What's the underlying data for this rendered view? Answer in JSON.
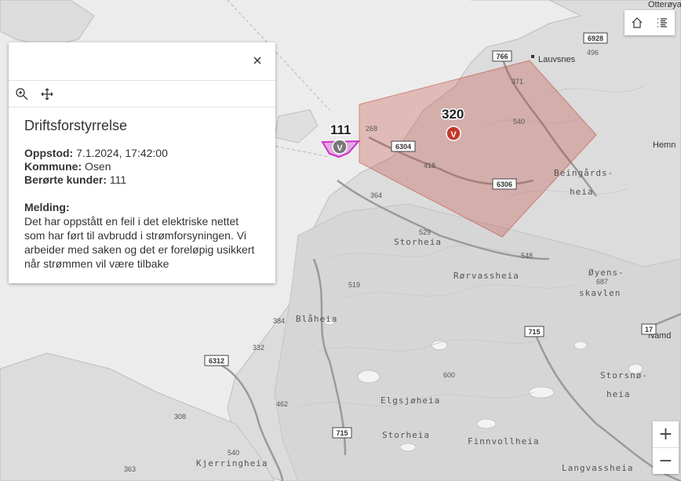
{
  "popup": {
    "title": "Driftsforstyrrelse",
    "fields": [
      {
        "label": "Oppstod:",
        "value": "7.1.2024, 17:42:00"
      },
      {
        "label": "Kommune:",
        "value": "Osen"
      },
      {
        "label": "Berørte kunder:",
        "value": "111"
      }
    ],
    "message_label": "Melding:",
    "message": "Det har oppstått en feil i det elektriske nettet som har ført til avbrudd i strømforsyningen. Vi arbeider med saken og det er foreløpig usikkert når strømmen vil være tilbake"
  },
  "outages": [
    {
      "count": "111",
      "color": "#cc33cc"
    },
    {
      "count": "320",
      "color": "#c0392b"
    }
  ],
  "places": {
    "ottervya": "Otterøya",
    "lauvsnes": "Lauvsnes",
    "hemne": "Hemn",
    "beingardsheia_1": "Beingårds-",
    "beingardsheia_2": "heia",
    "storheia_1": "Storheia",
    "rorvassheia": "Rørvassheia",
    "oyensskavlen_1": "Øyens-",
    "oyensskavlen_2": "skavlen",
    "blaheia": "Blåheia",
    "namd": "Namd",
    "storsnoheia_1": "Storsnø-",
    "storsnoheia_2": "heia",
    "elgsjoheia": "Elgsjøheia",
    "storheia_2": "Storheia",
    "finnvollheia": "Finnvollheia",
    "kjerringheia": "Kjerringheia",
    "langvassheia": "Langvassheia"
  },
  "roads": [
    "6928",
    "766",
    "6304",
    "6306",
    "715",
    "6312",
    "715",
    "17"
  ],
  "elevations": [
    "496",
    "371",
    "540",
    "268",
    "418",
    "364",
    "529",
    "548",
    "519",
    "687",
    "384",
    "332",
    "600",
    "462",
    "308",
    "540",
    "363"
  ],
  "widgets": {
    "zoom_in": "+",
    "zoom_out": "−"
  }
}
